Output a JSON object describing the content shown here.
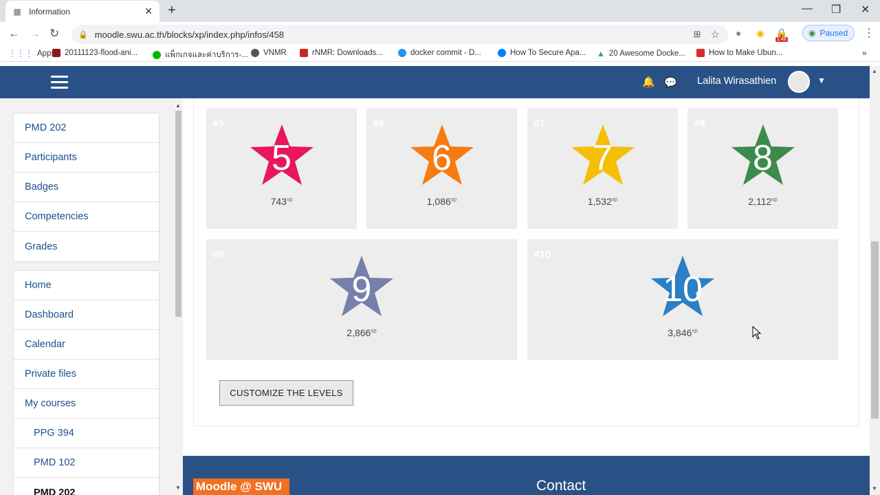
{
  "browser": {
    "tab_title": "Information",
    "url": "moodle.swu.ac.th/blocks/xp/index.php/infos/458",
    "profile_status": "Paused",
    "ext_badge": "1:46",
    "bookmarks": [
      {
        "label": "Apps",
        "color": "#4285f4"
      },
      {
        "label": "20111123-flood-ani...",
        "color": "#8b1a1a"
      },
      {
        "label": "แพ็กเกจและค่าบริการ-...",
        "color": "#00b900"
      },
      {
        "label": "VNMR",
        "color": "#555555"
      },
      {
        "label": "rNMR: Downloads...",
        "color": "#c62828"
      },
      {
        "label": "docker commit - D...",
        "color": "#2496ed"
      },
      {
        "label": "How To Secure Apa...",
        "color": "#0080ff"
      },
      {
        "label": "20 Awesome Docke...",
        "color": "#34a853"
      },
      {
        "label": "How to Make Ubun...",
        "color": "#d32f2f"
      }
    ]
  },
  "header": {
    "user_name": "Lalita Wirasathien"
  },
  "sidebar": {
    "course_nav": [
      {
        "label": "PMD 202"
      },
      {
        "label": "Participants"
      },
      {
        "label": "Badges"
      },
      {
        "label": "Competencies"
      },
      {
        "label": "Grades"
      }
    ],
    "site_nav": [
      {
        "label": "Home"
      },
      {
        "label": "Dashboard"
      },
      {
        "label": "Calendar"
      },
      {
        "label": "Private files"
      },
      {
        "label": "My courses"
      },
      {
        "label": "PPG 394"
      },
      {
        "label": "PMD 102"
      },
      {
        "label": "PMD 202"
      }
    ]
  },
  "levels": [
    {
      "tag": "#5",
      "level": "5",
      "xp": "743",
      "color": "#e8175d"
    },
    {
      "tag": "#6",
      "level": "6",
      "xp": "1,086",
      "color": "#f77b13"
    },
    {
      "tag": "#7",
      "level": "7",
      "xp": "1,532",
      "color": "#f5be09"
    },
    {
      "tag": "#8",
      "level": "8",
      "xp": "2,112",
      "color": "#3d8b4b"
    },
    {
      "tag": "#9",
      "level": "9",
      "xp": "2,866",
      "color": "#7680ab"
    },
    {
      "tag": "#10",
      "level": "10",
      "xp": "3,846",
      "color": "#2b7fc2"
    }
  ],
  "xp_suffix": "xp",
  "customize_button": "CUSTOMIZE THE LEVELS",
  "footer": {
    "logo": "Moodle @ SWU",
    "contact": "Contact"
  }
}
